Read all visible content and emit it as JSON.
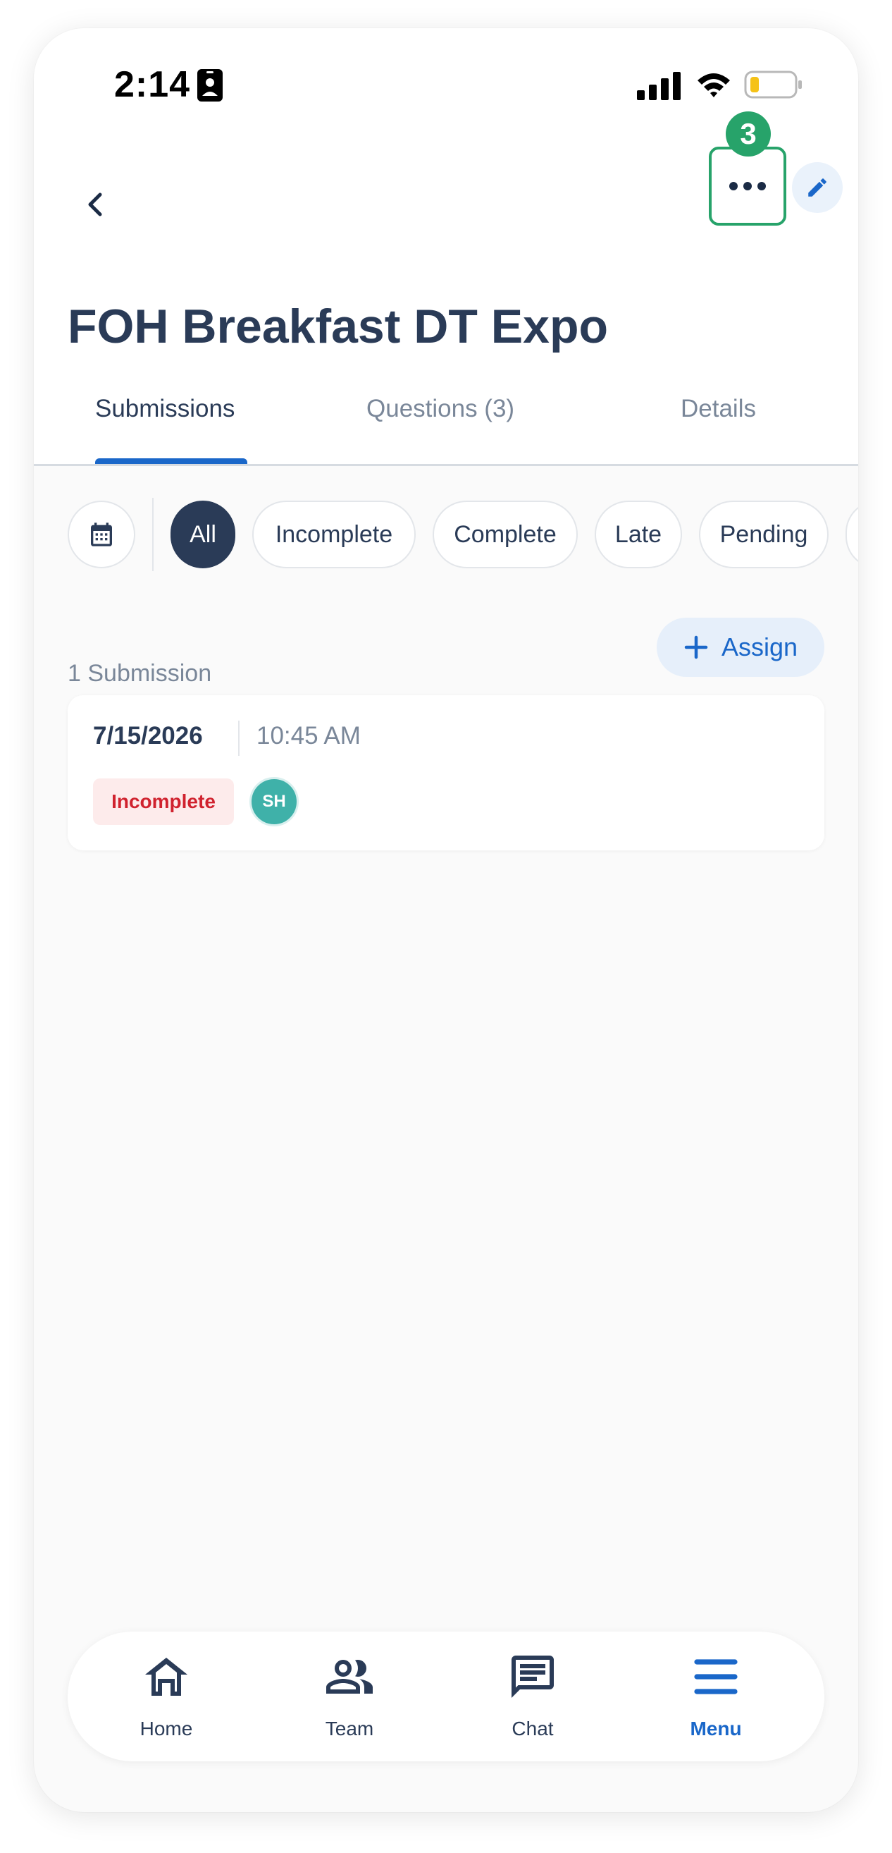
{
  "status_bar": {
    "time": "2:14"
  },
  "header": {
    "step_badge": "3"
  },
  "page": {
    "title": "FOH Breakfast DT Expo"
  },
  "tabs": [
    {
      "label": "Submissions"
    },
    {
      "label": "Questions (3)"
    },
    {
      "label": "Details"
    }
  ],
  "filters": [
    {
      "label": "All"
    },
    {
      "label": "Incomplete"
    },
    {
      "label": "Complete"
    },
    {
      "label": "Late"
    },
    {
      "label": "Pending"
    }
  ],
  "submissions": {
    "count_label": "1 Submission",
    "assign_label": "Assign",
    "items": [
      {
        "date": "7/15/2026",
        "time": "10:45 AM",
        "status": "Incomplete",
        "avatar_initials": "SH"
      }
    ]
  },
  "bottom_nav": [
    {
      "label": "Home",
      "icon": "home-icon"
    },
    {
      "label": "Team",
      "icon": "team-icon"
    },
    {
      "label": "Chat",
      "icon": "chat-icon"
    },
    {
      "label": "Menu",
      "icon": "menu-icon"
    }
  ],
  "colors": {
    "accent": "#1a67c9",
    "navy": "#2a3b57",
    "highlight": "#27a36a",
    "incomplete": "#d0222e",
    "avatar": "#3fb1a9"
  }
}
